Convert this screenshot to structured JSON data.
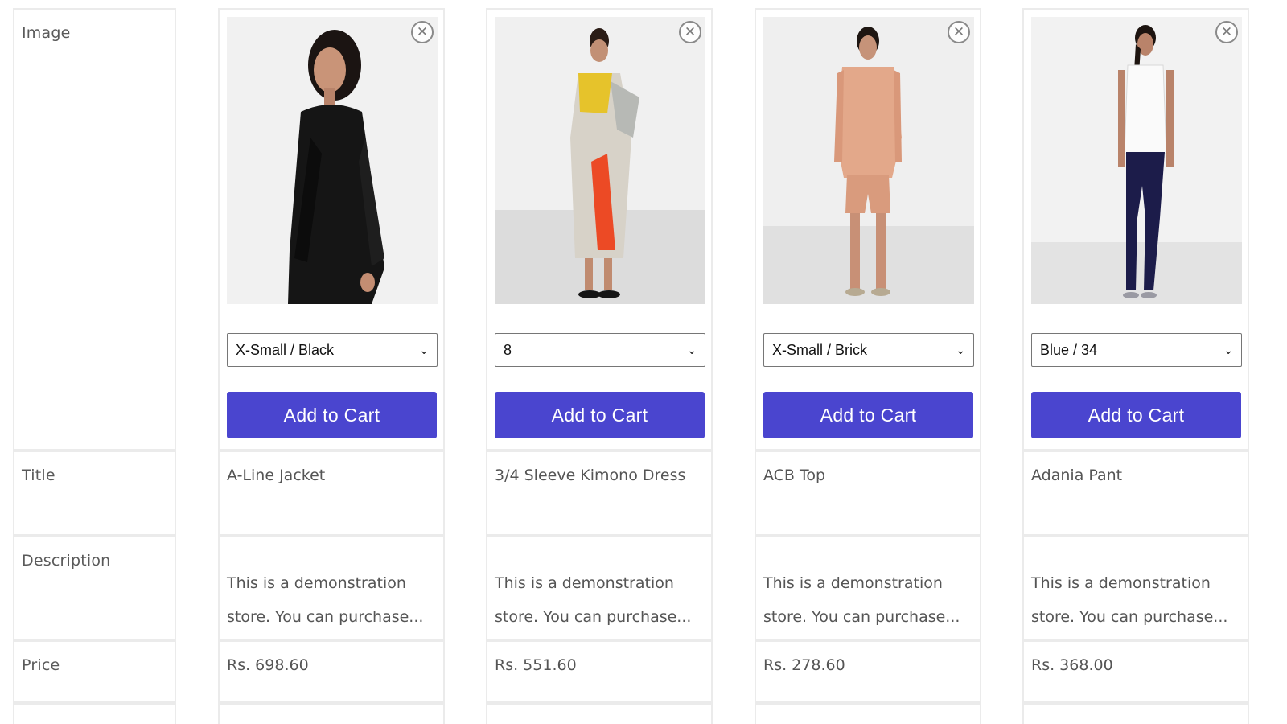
{
  "row_labels": {
    "image": "Image",
    "title": "Title",
    "description": "Description",
    "price": "Price"
  },
  "remove_icon": "close-circle-icon",
  "add_to_cart_label": "Add to Cart",
  "accent_color": "#4a45cf",
  "products": [
    {
      "title": "A-Line Jacket",
      "variant": "X-Small / Black",
      "description_line1": "This is a demonstration",
      "description_line2": "store. You can purchase...",
      "price": "Rs. 698.60"
    },
    {
      "title": "3/4 Sleeve Kimono Dress",
      "variant": "8",
      "description_line1": "This is a demonstration",
      "description_line2": "store. You can purchase...",
      "price": "Rs. 551.60"
    },
    {
      "title": "ACB Top",
      "variant": "X-Small / Brick",
      "description_line1": "This is a demonstration",
      "description_line2": "store. You can purchase...",
      "price": "Rs. 278.60"
    },
    {
      "title": "Adania Pant",
      "variant": "Blue / 34",
      "description_line1": "This is a demonstration",
      "description_line2": "store. You can purchase...",
      "price": "Rs. 368.00"
    }
  ]
}
